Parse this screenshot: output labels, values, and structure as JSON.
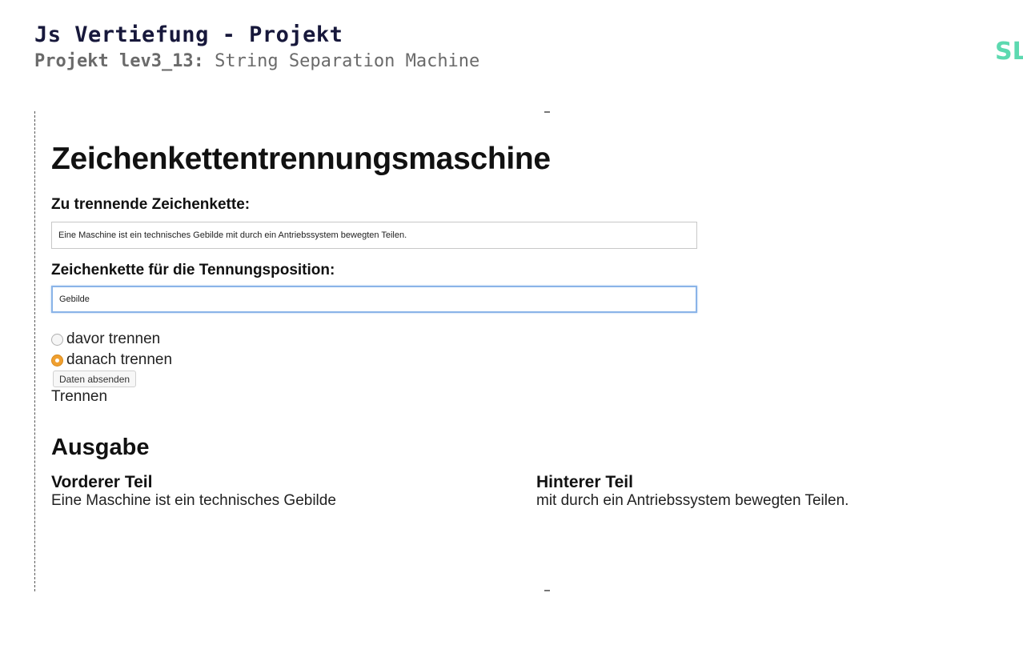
{
  "slide": {
    "title": "Js Vertiefung - Projekt",
    "subtitle_prefix": "Projekt lev3_13:",
    "subtitle_text": " String Separation Machine",
    "brand": "SL"
  },
  "app": {
    "heading": "Zeichenkettentrennungsmaschine",
    "string_label": "Zu trennende Zeichenkette:",
    "string_value": "Eine Maschine ist ein technisches Gebilde mit durch ein Antriebssystem bewegten Teilen.",
    "separator_label": "Zeichenkette für die Tennungsposition:",
    "separator_value": "Gebilde",
    "radio_before": "davor trennen",
    "radio_after": "danach trennen",
    "selected_option": "radio_after",
    "submit_label": "Daten absenden",
    "trennen_text": "Trennen",
    "output_heading": "Ausgabe",
    "front_title": "Vorderer Teil",
    "front_text": "Eine Maschine ist ein technisches Gebilde",
    "back_title": "Hinterer Teil",
    "back_text": "mit durch ein Antriebssystem bewegten Teilen."
  },
  "colors": {
    "title": "#17183b",
    "subtitle": "#6a6a6a",
    "brand": "#5dd9b0",
    "radio_checked": "#f0a030",
    "focus_border": "#8ab4e8"
  }
}
